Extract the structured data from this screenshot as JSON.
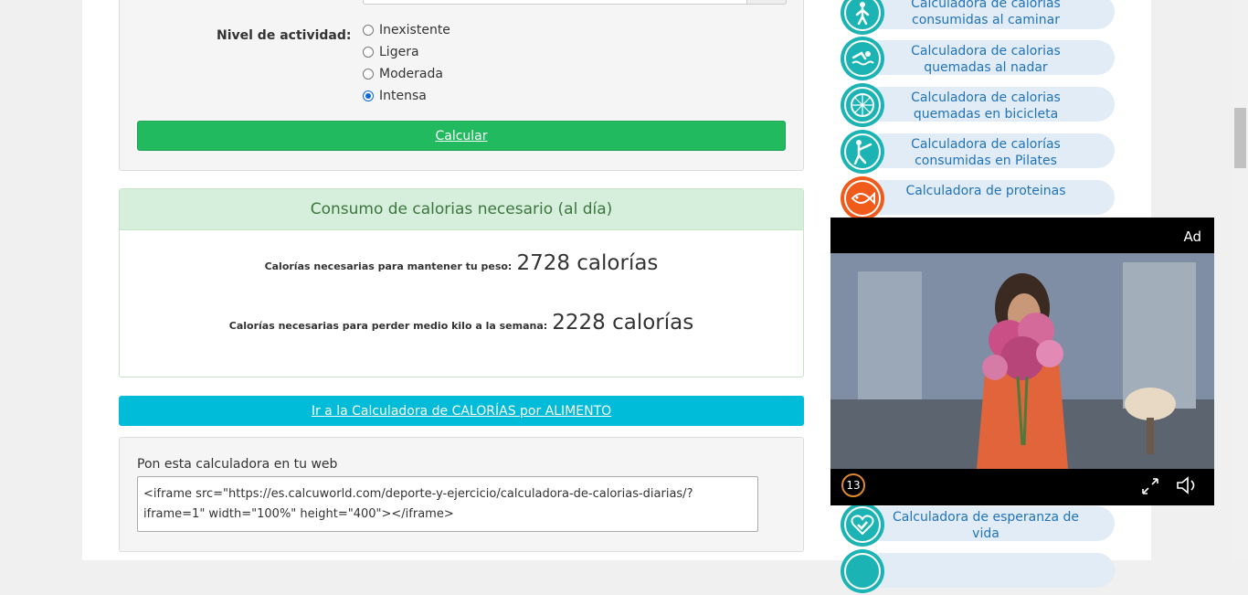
{
  "form": {
    "activity_label": "Nivel de actividad:",
    "options": [
      "Inexistente",
      "Ligera",
      "Moderada",
      "Intensa"
    ],
    "selected": "Intensa",
    "calc_button": "Calcular"
  },
  "result": {
    "title": "Consumo de calorias necesario (al día)",
    "maintain_label": "Calorías necesarias para mantener tu peso:",
    "maintain_value": "2728 calorías",
    "lose_label": "Calorías necesarias para perder medio kilo a la semana:",
    "lose_value": "2228 calorías"
  },
  "food_link": "Ir a la Calculadora de CALORÍAS por ALIMENTO",
  "embed": {
    "title": "Pon esta calculadora en tu web",
    "code": "<iframe src=\"https://es.calcuworld.com/deporte-y-ejercicio/calculadora-de-calorias-diarias/?iframe=1\" width=\"100%\" height=\"400\"></iframe>"
  },
  "sidebar": [
    {
      "line1": "Calculadora de calorias",
      "line2": "consumidas al caminar",
      "icon": "walking-icon",
      "color": "#1bb3b3"
    },
    {
      "line1": "Calculadora de calorias",
      "line2": "quemadas al nadar",
      "icon": "swimming-icon",
      "color": "#1bb3b3"
    },
    {
      "line1": "Calculadora de calorias",
      "line2": "quemadas en bicicleta",
      "icon": "bicycle-wheel-icon",
      "color": "#1bb3b3"
    },
    {
      "line1": "Calculadora de calorías",
      "line2": "consumidas en Pilates",
      "icon": "pilates-icon",
      "color": "#1bb3b3"
    },
    {
      "line1": "Calculadora de proteinas",
      "line2": "",
      "icon": "fish-icon",
      "color": "#f05a1a"
    },
    {
      "line1": "Calculadora de esperanza de",
      "line2": "vida",
      "icon": "heart-check-icon",
      "color": "#1bb3b3"
    }
  ],
  "ad": {
    "label": "Ad",
    "counter": "13"
  }
}
